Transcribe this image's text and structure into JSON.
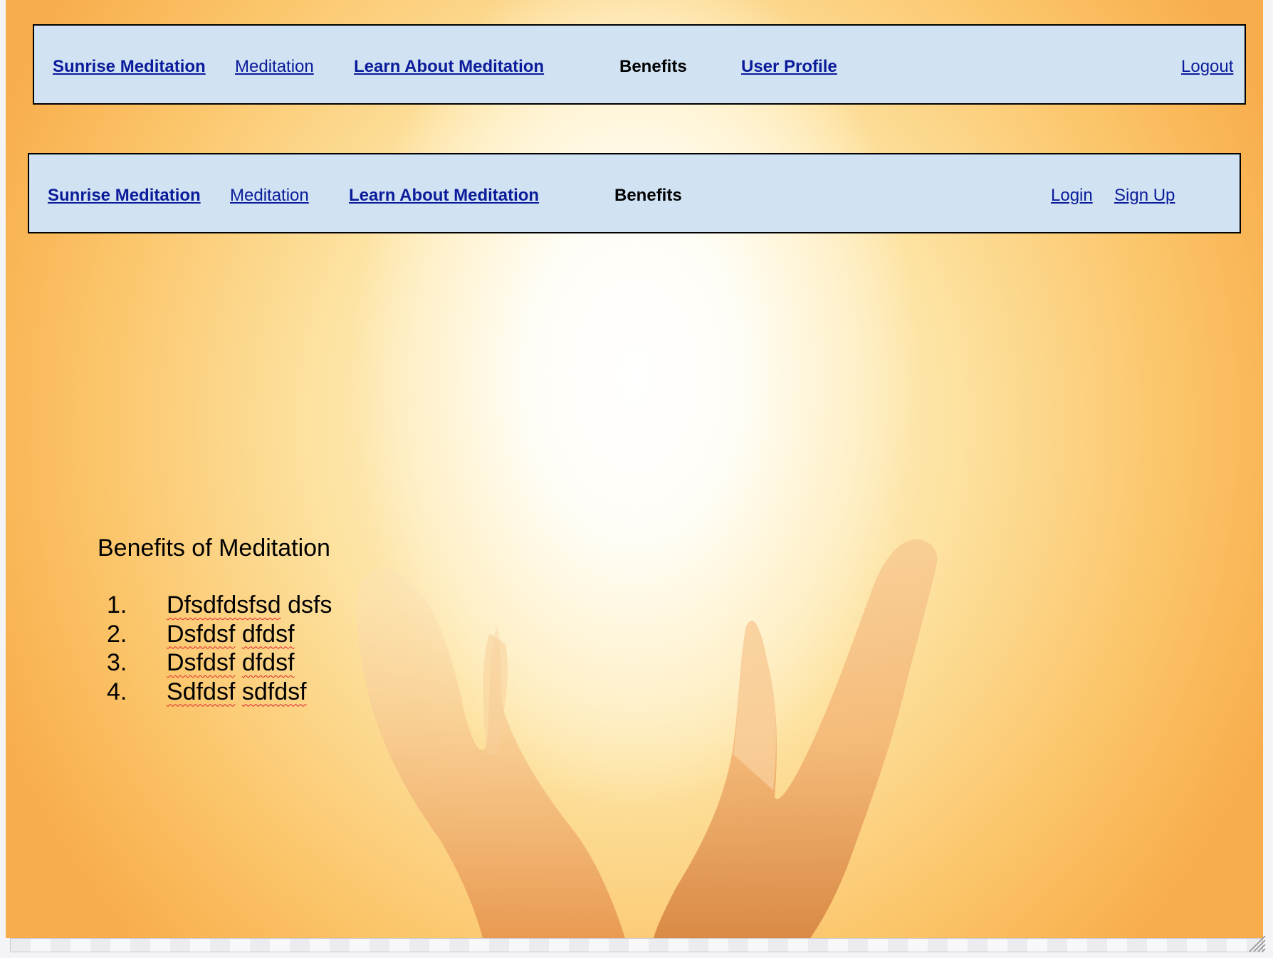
{
  "nav_logged_in": {
    "brand": "Sunrise Meditation",
    "meditation": "Meditation",
    "learn": "Learn About Meditation",
    "benefits": "Benefits",
    "user_profile": "User Profile",
    "logout": "Logout"
  },
  "nav_logged_out": {
    "brand": "Sunrise Meditation",
    "meditation": "Meditation",
    "learn": "Learn About Meditation",
    "benefits": "Benefits",
    "login": "Login",
    "signup": "Sign Up"
  },
  "main": {
    "heading": "Benefits of Meditation",
    "items": [
      {
        "number": "1.",
        "words": [
          "Dfsdfdsfsd",
          "dsfs"
        ]
      },
      {
        "number": "2.",
        "words": [
          "Dsfdsf",
          "dfdsf"
        ]
      },
      {
        "number": "3.",
        "words": [
          "Dsfdsf",
          "dfdsf"
        ]
      },
      {
        "number": "4.",
        "words": [
          "Sdfdsf",
          "sdfdsf"
        ]
      }
    ]
  },
  "colors": {
    "nav_background": "#d1e2f2",
    "link": "#0b1c9b",
    "spellcheck_underline": "#e0202a",
    "sun_glow": "#fffdf6",
    "sun_edge": "#f8ad4c"
  },
  "background_image": "sunrise-hands-illustration"
}
